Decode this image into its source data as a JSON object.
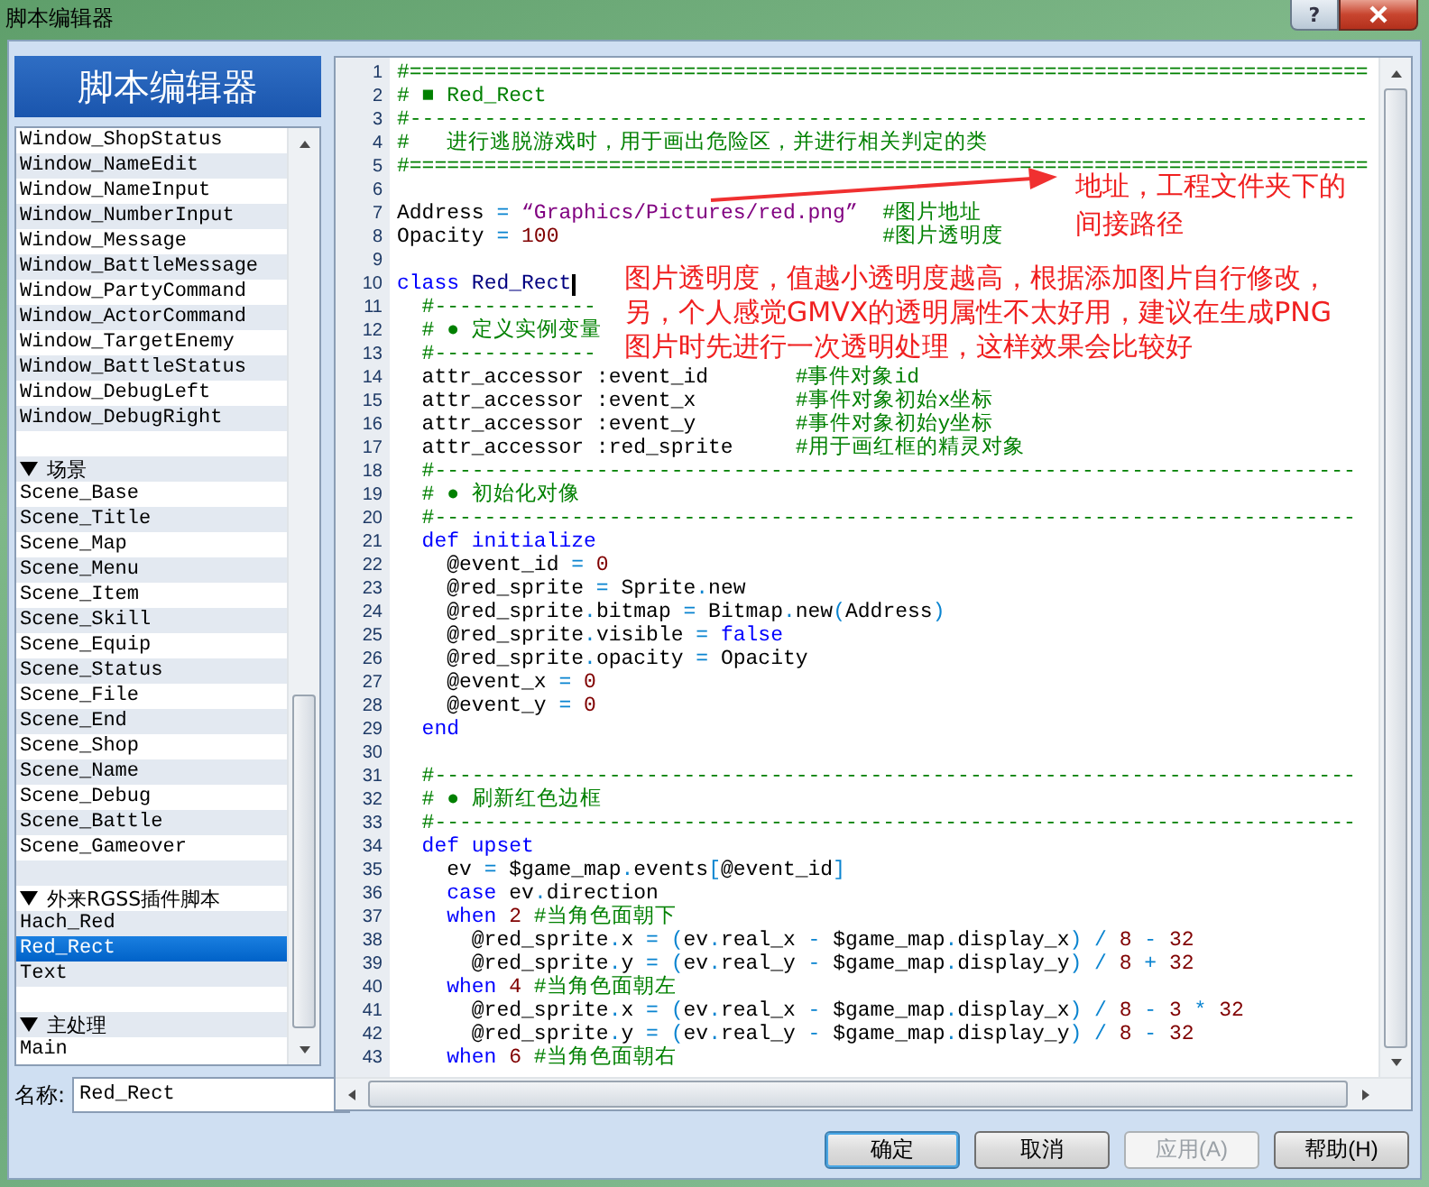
{
  "window": {
    "title": "脚本编辑器",
    "help_label": "?"
  },
  "sidebar": {
    "banner": "脚本编辑器",
    "sections": [
      {
        "items": [
          {
            "label": "Window_ShopStatus",
            "selected": false
          },
          {
            "label": "Window_NameEdit",
            "selected": false
          },
          {
            "label": "Window_NameInput",
            "selected": false
          },
          {
            "label": "Window_NumberInput",
            "selected": false
          },
          {
            "label": "Window_Message",
            "selected": false
          },
          {
            "label": "Window_BattleMessage",
            "selected": false
          },
          {
            "label": "Window_PartyCommand",
            "selected": false
          },
          {
            "label": "Window_ActorCommand",
            "selected": false
          },
          {
            "label": "Window_TargetEnemy",
            "selected": false
          },
          {
            "label": "Window_BattleStatus",
            "selected": false
          },
          {
            "label": "Window_DebugLeft",
            "selected": false
          },
          {
            "label": "Window_DebugRight",
            "selected": false
          }
        ]
      },
      {
        "title": "场景",
        "expanded": true,
        "items": [
          {
            "label": "Scene_Base",
            "selected": false
          },
          {
            "label": "Scene_Title",
            "selected": false
          },
          {
            "label": "Scene_Map",
            "selected": false
          },
          {
            "label": "Scene_Menu",
            "selected": false
          },
          {
            "label": "Scene_Item",
            "selected": false
          },
          {
            "label": "Scene_Skill",
            "selected": false
          },
          {
            "label": "Scene_Equip",
            "selected": false
          },
          {
            "label": "Scene_Status",
            "selected": false
          },
          {
            "label": "Scene_File",
            "selected": false
          },
          {
            "label": "Scene_End",
            "selected": false
          },
          {
            "label": "Scene_Shop",
            "selected": false
          },
          {
            "label": "Scene_Name",
            "selected": false
          },
          {
            "label": "Scene_Debug",
            "selected": false
          },
          {
            "label": "Scene_Battle",
            "selected": false
          },
          {
            "label": "Scene_Gameover",
            "selected": false
          }
        ]
      },
      {
        "title": "外来RGSS插件脚本",
        "expanded": true,
        "items": [
          {
            "label": "Hach_Red",
            "selected": false
          },
          {
            "label": "Red_Rect",
            "selected": true
          },
          {
            "label": "Text",
            "selected": false
          }
        ]
      },
      {
        "title": "主处理",
        "expanded": true,
        "items": [
          {
            "label": "Main",
            "selected": false
          }
        ]
      }
    ],
    "name_label": "名称:",
    "name_value": "Red_Rect"
  },
  "code": {
    "lines": [
      {
        "n": "1",
        "tokens": [
          {
            "kind": "comment",
            "text": "#============================================================================="
          }
        ]
      },
      {
        "n": "2",
        "tokens": [
          {
            "kind": "comment",
            "text": "# ■ Red_Rect"
          }
        ]
      },
      {
        "n": "3",
        "tokens": [
          {
            "kind": "comment",
            "text": "#-----------------------------------------------------------------------------"
          }
        ]
      },
      {
        "n": "4",
        "tokens": [
          {
            "kind": "comment",
            "text": "#   进行逃脱游戏时，用于画出危险区，并进行相关判定的类"
          }
        ]
      },
      {
        "n": "5",
        "tokens": [
          {
            "kind": "comment",
            "text": "#============================================================================="
          }
        ]
      },
      {
        "n": "6"
      },
      {
        "n": "7",
        "tokens": [
          {
            "kind": "plain",
            "text": "Address "
          },
          {
            "kind": "operator",
            "text": "="
          },
          {
            "kind": "string",
            "text": " “Graphics/Pictures/red.png”"
          },
          {
            "kind": "comment",
            "text": "  #图片地址"
          }
        ]
      },
      {
        "n": "8",
        "tokens": [
          {
            "kind": "plain",
            "text": "Opacity "
          },
          {
            "kind": "operator",
            "text": "="
          },
          {
            "kind": "number",
            "text": " 100"
          },
          {
            "kind": "comment",
            "text": "                          #图片透明度"
          }
        ]
      },
      {
        "n": "9"
      },
      {
        "n": "10",
        "tokens": [
          {
            "kind": "keyword",
            "text": "class"
          },
          {
            "kind": "constant",
            "text": " Red_Rect"
          }
        ],
        "cursor": true
      },
      {
        "n": "11",
        "tokens": [
          {
            "kind": "comment",
            "text": "  #-------------"
          }
        ]
      },
      {
        "n": "12",
        "tokens": [
          {
            "kind": "comment",
            "text": "  # ● 定义实例变量"
          }
        ]
      },
      {
        "n": "13",
        "tokens": [
          {
            "kind": "comment",
            "text": "  #-------------"
          }
        ]
      },
      {
        "n": "14",
        "tokens": [
          {
            "kind": "plain",
            "text": "  attr_accessor :event_id"
          },
          {
            "kind": "comment",
            "text": "       #事件对象id"
          }
        ]
      },
      {
        "n": "15",
        "tokens": [
          {
            "kind": "plain",
            "text": "  attr_accessor :event_x"
          },
          {
            "kind": "comment",
            "text": "        #事件对象初始x坐标"
          }
        ]
      },
      {
        "n": "16",
        "tokens": [
          {
            "kind": "plain",
            "text": "  attr_accessor :event_y"
          },
          {
            "kind": "comment",
            "text": "        #事件对象初始y坐标"
          }
        ]
      },
      {
        "n": "17",
        "tokens": [
          {
            "kind": "plain",
            "text": "  attr_accessor :red_sprite"
          },
          {
            "kind": "comment",
            "text": "     #用于画红框的精灵对象"
          }
        ]
      },
      {
        "n": "18",
        "tokens": [
          {
            "kind": "comment",
            "text": "  #--------------------------------------------------------------------------"
          }
        ]
      },
      {
        "n": "19",
        "tokens": [
          {
            "kind": "comment",
            "text": "  # ● 初始化对像"
          }
        ]
      },
      {
        "n": "20",
        "tokens": [
          {
            "kind": "comment",
            "text": "  #--------------------------------------------------------------------------"
          }
        ]
      },
      {
        "n": "21",
        "tokens": [
          {
            "kind": "keyword",
            "text": "  def initialize"
          }
        ]
      },
      {
        "n": "22",
        "tokens": [
          {
            "kind": "plain",
            "text": "    @event_id "
          },
          {
            "kind": "operator",
            "text": "="
          },
          {
            "kind": "number",
            "text": " 0"
          }
        ]
      },
      {
        "n": "23",
        "tokens": [
          {
            "kind": "plain",
            "text": "    @red_sprite "
          },
          {
            "kind": "operator",
            "text": "="
          },
          {
            "kind": "plain",
            "text": " Sprite"
          },
          {
            "kind": "operator",
            "text": "."
          },
          {
            "kind": "plain",
            "text": "new"
          }
        ]
      },
      {
        "n": "24",
        "tokens": [
          {
            "kind": "plain",
            "text": "    @red_sprite"
          },
          {
            "kind": "operator",
            "text": "."
          },
          {
            "kind": "plain",
            "text": "bitmap "
          },
          {
            "kind": "operator",
            "text": "="
          },
          {
            "kind": "plain",
            "text": " Bitmap"
          },
          {
            "kind": "operator",
            "text": "."
          },
          {
            "kind": "plain",
            "text": "new"
          },
          {
            "kind": "operator",
            "text": "("
          },
          {
            "kind": "plain",
            "text": "Address"
          },
          {
            "kind": "operator",
            "text": ")"
          }
        ]
      },
      {
        "n": "25",
        "tokens": [
          {
            "kind": "plain",
            "text": "    @red_sprite"
          },
          {
            "kind": "operator",
            "text": "."
          },
          {
            "kind": "plain",
            "text": "visible "
          },
          {
            "kind": "operator",
            "text": "="
          },
          {
            "kind": "keyword",
            "text": " false"
          }
        ]
      },
      {
        "n": "26",
        "tokens": [
          {
            "kind": "plain",
            "text": "    @red_sprite"
          },
          {
            "kind": "operator",
            "text": "."
          },
          {
            "kind": "plain",
            "text": "opacity "
          },
          {
            "kind": "operator",
            "text": "="
          },
          {
            "kind": "plain",
            "text": " Opacity"
          }
        ]
      },
      {
        "n": "27",
        "tokens": [
          {
            "kind": "plain",
            "text": "    @event_x "
          },
          {
            "kind": "operator",
            "text": "="
          },
          {
            "kind": "number",
            "text": " 0"
          }
        ]
      },
      {
        "n": "28",
        "tokens": [
          {
            "kind": "plain",
            "text": "    @event_y "
          },
          {
            "kind": "operator",
            "text": "="
          },
          {
            "kind": "number",
            "text": " 0"
          }
        ]
      },
      {
        "n": "29",
        "tokens": [
          {
            "kind": "keyword",
            "text": "  end"
          }
        ]
      },
      {
        "n": "30"
      },
      {
        "n": "31",
        "tokens": [
          {
            "kind": "comment",
            "text": "  #--------------------------------------------------------------------------"
          }
        ]
      },
      {
        "n": "32",
        "tokens": [
          {
            "kind": "comment",
            "text": "  # ● 刷新红色边框"
          }
        ]
      },
      {
        "n": "33",
        "tokens": [
          {
            "kind": "comment",
            "text": "  #--------------------------------------------------------------------------"
          }
        ]
      },
      {
        "n": "34",
        "tokens": [
          {
            "kind": "keyword",
            "text": "  def upset"
          }
        ]
      },
      {
        "n": "35",
        "tokens": [
          {
            "kind": "plain",
            "text": "    ev "
          },
          {
            "kind": "operator",
            "text": "="
          },
          {
            "kind": "plain",
            "text": " $game_map"
          },
          {
            "kind": "operator",
            "text": "."
          },
          {
            "kind": "plain",
            "text": "events"
          },
          {
            "kind": "operator",
            "text": "["
          },
          {
            "kind": "plain",
            "text": "@event_id"
          },
          {
            "kind": "operator",
            "text": "]"
          }
        ]
      },
      {
        "n": "36",
        "tokens": [
          {
            "kind": "keyword",
            "text": "    case"
          },
          {
            "kind": "plain",
            "text": " ev"
          },
          {
            "kind": "operator",
            "text": "."
          },
          {
            "kind": "plain",
            "text": "direction"
          }
        ]
      },
      {
        "n": "37",
        "tokens": [
          {
            "kind": "keyword",
            "text": "    when"
          },
          {
            "kind": "number",
            "text": " 2"
          },
          {
            "kind": "comment",
            "text": " #当角色面朝下"
          }
        ]
      },
      {
        "n": "38",
        "tokens": [
          {
            "kind": "plain",
            "text": "      @red_sprite"
          },
          {
            "kind": "operator",
            "text": "."
          },
          {
            "kind": "plain",
            "text": "x "
          },
          {
            "kind": "operator",
            "text": "="
          },
          {
            "kind": "operator",
            "text": " ("
          },
          {
            "kind": "plain",
            "text": "ev"
          },
          {
            "kind": "operator",
            "text": "."
          },
          {
            "kind": "plain",
            "text": "real_x "
          },
          {
            "kind": "operator",
            "text": "-"
          },
          {
            "kind": "plain",
            "text": " $game_map"
          },
          {
            "kind": "operator",
            "text": "."
          },
          {
            "kind": "plain",
            "text": "display_x"
          },
          {
            "kind": "operator",
            "text": ")"
          },
          {
            "kind": "operator",
            "text": " /"
          },
          {
            "kind": "number",
            "text": " 8"
          },
          {
            "kind": "operator",
            "text": " -"
          },
          {
            "kind": "number",
            "text": " 32"
          }
        ]
      },
      {
        "n": "39",
        "tokens": [
          {
            "kind": "plain",
            "text": "      @red_sprite"
          },
          {
            "kind": "operator",
            "text": "."
          },
          {
            "kind": "plain",
            "text": "y "
          },
          {
            "kind": "operator",
            "text": "="
          },
          {
            "kind": "operator",
            "text": " ("
          },
          {
            "kind": "plain",
            "text": "ev"
          },
          {
            "kind": "operator",
            "text": "."
          },
          {
            "kind": "plain",
            "text": "real_y "
          },
          {
            "kind": "operator",
            "text": "-"
          },
          {
            "kind": "plain",
            "text": " $game_map"
          },
          {
            "kind": "operator",
            "text": "."
          },
          {
            "kind": "plain",
            "text": "display_y"
          },
          {
            "kind": "operator",
            "text": ")"
          },
          {
            "kind": "operator",
            "text": " /"
          },
          {
            "kind": "number",
            "text": " 8"
          },
          {
            "kind": "operator",
            "text": " +"
          },
          {
            "kind": "number",
            "text": " 32"
          }
        ]
      },
      {
        "n": "40",
        "tokens": [
          {
            "kind": "keyword",
            "text": "    when"
          },
          {
            "kind": "number",
            "text": " 4"
          },
          {
            "kind": "comment",
            "text": " #当角色面朝左"
          }
        ]
      },
      {
        "n": "41",
        "tokens": [
          {
            "kind": "plain",
            "text": "      @red_sprite"
          },
          {
            "kind": "operator",
            "text": "."
          },
          {
            "kind": "plain",
            "text": "x "
          },
          {
            "kind": "operator",
            "text": "="
          },
          {
            "kind": "operator",
            "text": " ("
          },
          {
            "kind": "plain",
            "text": "ev"
          },
          {
            "kind": "operator",
            "text": "."
          },
          {
            "kind": "plain",
            "text": "real_x "
          },
          {
            "kind": "operator",
            "text": "-"
          },
          {
            "kind": "plain",
            "text": " $game_map"
          },
          {
            "kind": "operator",
            "text": "."
          },
          {
            "kind": "plain",
            "text": "display_x"
          },
          {
            "kind": "operator",
            "text": ")"
          },
          {
            "kind": "operator",
            "text": " /"
          },
          {
            "kind": "number",
            "text": " 8"
          },
          {
            "kind": "operator",
            "text": " -"
          },
          {
            "kind": "number",
            "text": " 3"
          },
          {
            "kind": "operator",
            "text": " *"
          },
          {
            "kind": "number",
            "text": " 32"
          }
        ]
      },
      {
        "n": "42",
        "tokens": [
          {
            "kind": "plain",
            "text": "      @red_sprite"
          },
          {
            "kind": "operator",
            "text": "."
          },
          {
            "kind": "plain",
            "text": "y "
          },
          {
            "kind": "operator",
            "text": "="
          },
          {
            "kind": "operator",
            "text": " ("
          },
          {
            "kind": "plain",
            "text": "ev"
          },
          {
            "kind": "operator",
            "text": "."
          },
          {
            "kind": "plain",
            "text": "real_y "
          },
          {
            "kind": "operator",
            "text": "-"
          },
          {
            "kind": "plain",
            "text": " $game_map"
          },
          {
            "kind": "operator",
            "text": "."
          },
          {
            "kind": "plain",
            "text": "display_y"
          },
          {
            "kind": "operator",
            "text": ")"
          },
          {
            "kind": "operator",
            "text": " /"
          },
          {
            "kind": "number",
            "text": " 8"
          },
          {
            "kind": "operator",
            "text": " -"
          },
          {
            "kind": "number",
            "text": " 32"
          }
        ]
      },
      {
        "n": "43",
        "tokens": [
          {
            "kind": "keyword",
            "text": "    when"
          },
          {
            "kind": "number",
            "text": " 6"
          },
          {
            "kind": "comment",
            "text": " #当角色面朝右"
          }
        ]
      }
    ],
    "annotations": [
      {
        "kind": "arrow-note",
        "lines": [
          "地址，工程文件夹下的",
          "间接路径"
        ]
      },
      {
        "kind": "note",
        "lines": [
          "图片透明度，值越小透明度越高，根据添加图片自行修改，",
          "另，个人感觉GMVX的透明属性不太好用，建议在生成PNG",
          "图片时先进行一次透明处理，这样效果会比较好"
        ]
      }
    ]
  },
  "buttons": [
    {
      "label": "确定",
      "default": true,
      "disabled": false
    },
    {
      "label": "取消",
      "default": false,
      "disabled": false
    },
    {
      "label": "应用(A)",
      "default": false,
      "disabled": true
    },
    {
      "label": "帮助(H)",
      "default": false,
      "disabled": false
    }
  ]
}
